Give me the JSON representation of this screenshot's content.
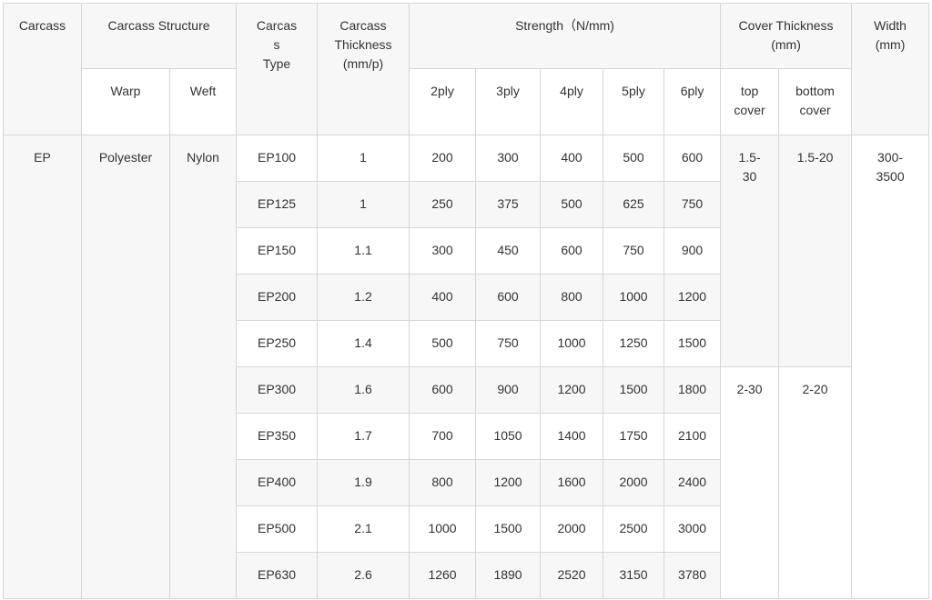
{
  "header": {
    "carcass": "Carcass",
    "structure": "Carcass Structure",
    "type": "Carcas\ns\nType",
    "thickness": "Carcass\nThickness\n(mm/p)",
    "strength": "Strength（N/mm)",
    "cover": "Cover Thickness\n(mm)",
    "width": "Width\n(mm)",
    "warp": "Warp",
    "weft": "Weft",
    "plies": [
      "2ply",
      "3ply",
      "4ply",
      "5ply",
      "6ply"
    ],
    "top_cover": "top\ncover",
    "bottom_cover": "bottom\ncover"
  },
  "body": {
    "carcass": "EP",
    "warp": "Polyester",
    "weft": "Nylon",
    "cover_group1": {
      "top": "1.5-\n30",
      "bottom": "1.5-20"
    },
    "cover_group2": {
      "top": "2-30",
      "bottom": "2-20"
    },
    "width": "300-\n3500"
  },
  "rows": [
    {
      "type": "EP100",
      "thickness": "1",
      "strength": [
        "200",
        "300",
        "400",
        "500",
        "600"
      ]
    },
    {
      "type": "EP125",
      "thickness": "1",
      "strength": [
        "250",
        "375",
        "500",
        "625",
        "750"
      ]
    },
    {
      "type": "EP150",
      "thickness": "1.1",
      "strength": [
        "300",
        "450",
        "600",
        "750",
        "900"
      ]
    },
    {
      "type": "EP200",
      "thickness": "1.2",
      "strength": [
        "400",
        "600",
        "800",
        "1000",
        "1200"
      ]
    },
    {
      "type": "EP250",
      "thickness": "1.4",
      "strength": [
        "500",
        "750",
        "1000",
        "1250",
        "1500"
      ]
    },
    {
      "type": "EP300",
      "thickness": "1.6",
      "strength": [
        "600",
        "900",
        "1200",
        "1500",
        "1800"
      ]
    },
    {
      "type": "EP350",
      "thickness": "1.7",
      "strength": [
        "700",
        "1050",
        "1400",
        "1750",
        "2100"
      ]
    },
    {
      "type": "EP400",
      "thickness": "1.9",
      "strength": [
        "800",
        "1200",
        "1600",
        "2000",
        "2400"
      ]
    },
    {
      "type": "EP500",
      "thickness": "2.1",
      "strength": [
        "1000",
        "1500",
        "2000",
        "2500",
        "3000"
      ]
    },
    {
      "type": "EP630",
      "thickness": "2.6",
      "strength": [
        "1260",
        "1890",
        "2520",
        "3150",
        "3780"
      ]
    }
  ]
}
